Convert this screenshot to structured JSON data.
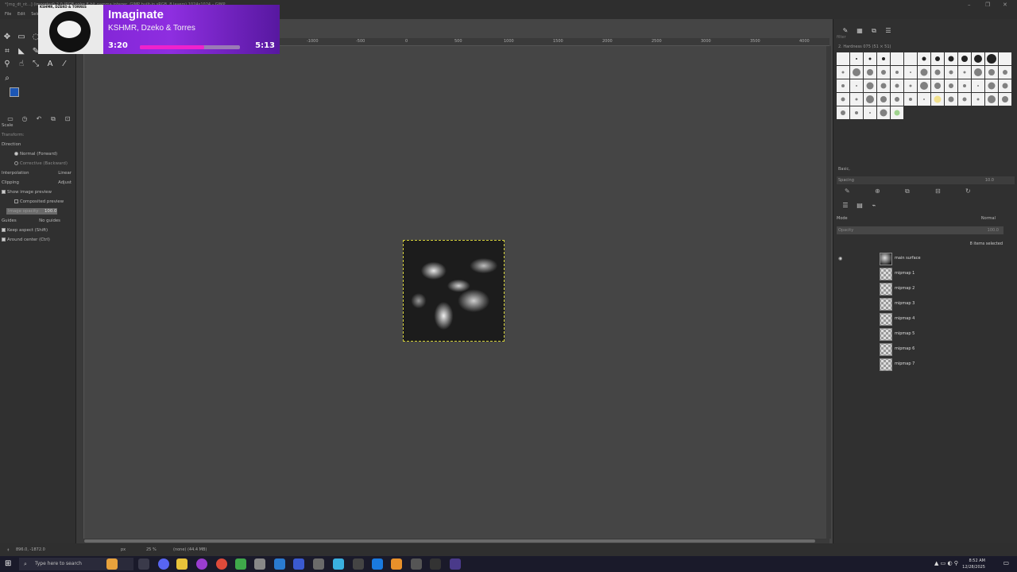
{
  "window": {
    "title": "*[rng_dt_nt...] (imported)-2.0 (RGB color 8-bit gamma integer, GIMP built-in sRGB, 8 layers) 1024x1024 – GIMP",
    "controls": [
      "–",
      "❐",
      "✕"
    ]
  },
  "menu": [
    "File",
    "Edit",
    "Select"
  ],
  "toolbox": {
    "tool_options_title": "Scale",
    "transform_label": "Transform:",
    "direction_label": "Direction",
    "direction_forward": "Normal (Forward)",
    "direction_backward": "Corrective (Backward)",
    "interpolation_label": "Interpolation",
    "interpolation_value": "Linear",
    "clipping_label": "Clipping",
    "clipping_value": "Adjust",
    "show_preview": "Show image preview",
    "composited_preview": "Composited preview",
    "image_opacity_label": "Image opacity",
    "image_opacity_value": "100.0",
    "guides_label": "Guides",
    "guides_value": "No guides",
    "keep_aspect": "Keep aspect (Shift)",
    "around_center": "Around center (Ctrl)",
    "fg_color": "#1c56b4",
    "bg_color": "#f4f4f4"
  },
  "rulers": {
    "h_ticks": [
      "-1000",
      "-500",
      "0",
      "500",
      "1000",
      "1500",
      "2000",
      "2500",
      "3000",
      "3500",
      "4000"
    ]
  },
  "status": {
    "coords": "896.0, -1872.0",
    "unit": "px",
    "zoom": "25 %",
    "info": "(none) (44.4 MB)"
  },
  "brushes": {
    "filter_placeholder": "filter",
    "current": "2. Hardness 075 (51 × 51)",
    "tag": "Basic,",
    "spacing_label": "Spacing",
    "spacing_value": "10.0"
  },
  "layers": {
    "mode_label": "Mode",
    "mode_value": "Normal",
    "opacity_label": "Opacity",
    "opacity_value": "100.0",
    "selected_count": "8 items selected",
    "items": [
      {
        "name": "main surface",
        "visible": true
      },
      {
        "name": "mipmap 1",
        "visible": false
      },
      {
        "name": "mipmap 2",
        "visible": false
      },
      {
        "name": "mipmap 3",
        "visible": false
      },
      {
        "name": "mipmap 4",
        "visible": false
      },
      {
        "name": "mipmap 5",
        "visible": false
      },
      {
        "name": "mipmap 6",
        "visible": false
      },
      {
        "name": "mipmap 7",
        "visible": false
      }
    ]
  },
  "now_playing": {
    "art_caption": "KSHMR, DZEKO & TORRES",
    "song": "Imaginate",
    "artist": "KSHMR, Dzeko & Torres",
    "elapsed": "3:20",
    "total": "5:13",
    "progress": 0.64,
    "accent": "#ee22cc"
  },
  "taskbar": {
    "search_placeholder": "Type here to search",
    "time": "8:52 AM",
    "date": "12/28/2025"
  }
}
